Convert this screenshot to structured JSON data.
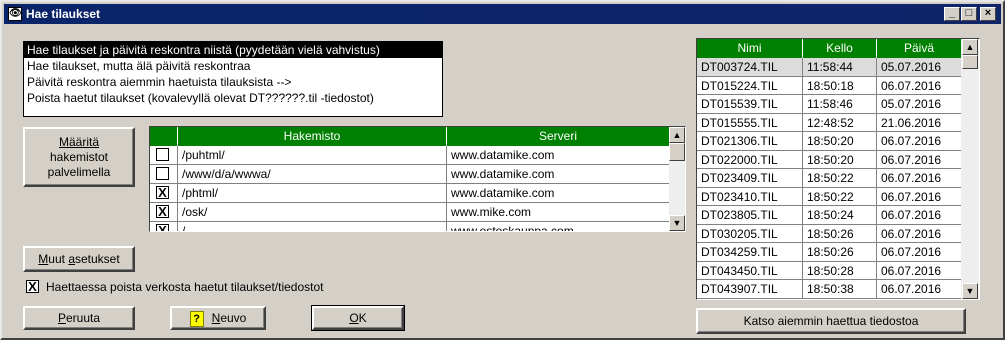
{
  "window": {
    "title": "Hae tilaukset",
    "minimize": "_",
    "maximize": "□",
    "close": "×"
  },
  "options": [
    "Hae tilaukset ja päivitä reskontra niistä (pyydetään vielä vahvistus)",
    "Hae tilaukset, mutta älä päivitä reskontraa",
    "Päivitä reskontra aiemmin haetuista tilauksista -->",
    "Poista haetut tilaukset (kovalevyllä olevat DT??????.til -tiedostot)"
  ],
  "buttons": {
    "maarita_line1": "Määritä",
    "maarita_line2": "hakemistot",
    "maarita_line3": "palvelimella",
    "muut_u": "M",
    "muut_pre": "uut ",
    "muut_u2": "a",
    "muut_post": "setukset",
    "peruuta_u": "P",
    "peruuta_rest": "eruuta",
    "neuvo_u": "N",
    "neuvo_rest": "euvo",
    "ok_u": "O",
    "ok_rest": "K",
    "katso": "Katso aiemmin haettua tiedostoa"
  },
  "checkbox_delete": {
    "checked": true,
    "mark": "X",
    "label": "Haettaessa poista verkosta haetut tilaukset/tiedostot"
  },
  "dir_table": {
    "headers": {
      "dir": "Hakemisto",
      "server": "Serveri"
    },
    "rows": [
      {
        "checked": false,
        "dir": "/puhtml/",
        "server": "www.datamike.com"
      },
      {
        "checked": false,
        "dir": "/www/d/a/wwwa/",
        "server": "www.datamike.com"
      },
      {
        "checked": true,
        "dir": "/phtml/",
        "server": "www.datamike.com"
      },
      {
        "checked": true,
        "dir": "/osk/",
        "server": "www.mike.com"
      },
      {
        "checked": true,
        "dir": "/",
        "server": "www.ostoskauppa.com"
      }
    ]
  },
  "file_table": {
    "headers": {
      "name": "Nimi",
      "time": "Kello",
      "date": "Päivä"
    },
    "rows": [
      {
        "name": "DT003724.TIL",
        "time": "11:58:44",
        "date": "05.07.2016"
      },
      {
        "name": "DT015224.TIL",
        "time": "18:50:18",
        "date": "06.07.2016"
      },
      {
        "name": "DT015539.TIL",
        "time": "11:58:46",
        "date": "05.07.2016"
      },
      {
        "name": "DT015555.TIL",
        "time": "12:48:52",
        "date": "21.06.2016"
      },
      {
        "name": "DT021306.TIL",
        "time": "18:50:20",
        "date": "06.07.2016"
      },
      {
        "name": "DT022000.TIL",
        "time": "18:50:20",
        "date": "06.07.2016"
      },
      {
        "name": "DT023409.TIL",
        "time": "18:50:22",
        "date": "06.07.2016"
      },
      {
        "name": "DT023410.TIL",
        "time": "18:50:22",
        "date": "06.07.2016"
      },
      {
        "name": "DT023805.TIL",
        "time": "18:50:24",
        "date": "06.07.2016"
      },
      {
        "name": "DT030205.TIL",
        "time": "18:50:26",
        "date": "06.07.2016"
      },
      {
        "name": "DT034259.TIL",
        "time": "18:50:26",
        "date": "06.07.2016"
      },
      {
        "name": "DT043450.TIL",
        "time": "18:50:28",
        "date": "06.07.2016"
      },
      {
        "name": "DT043907.TIL",
        "time": "18:50:38",
        "date": "06.07.2016"
      }
    ]
  },
  "icons": {
    "app": "eye-icon",
    "help": "question-mark-icon",
    "scroll_up": "▲",
    "scroll_down": "▼"
  },
  "colors": {
    "header_green": "#008000",
    "selection": "#000000",
    "titlebar": "#0a246a",
    "face": "#d4d0c8"
  }
}
